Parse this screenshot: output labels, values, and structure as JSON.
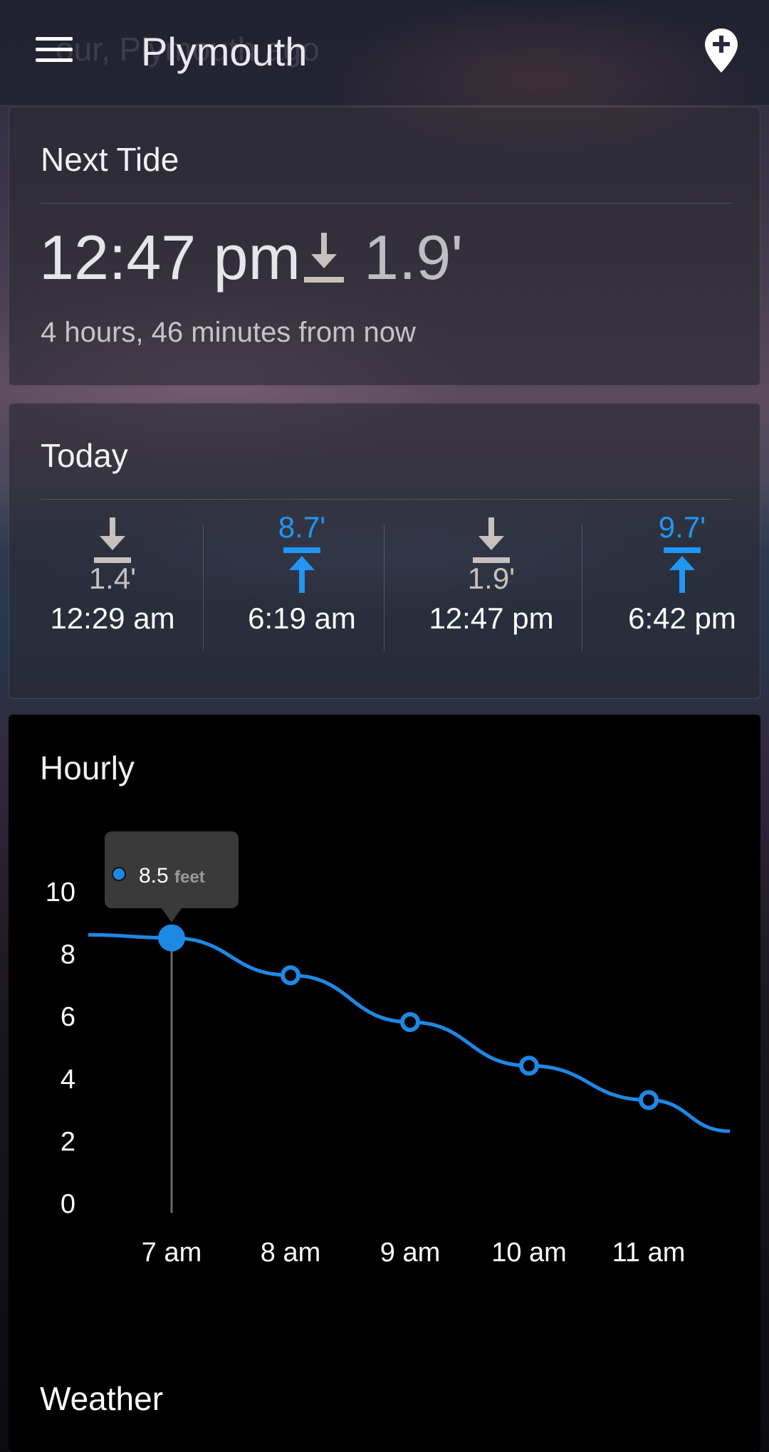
{
  "app_bar": {
    "ghost_text": "our, Plymouth          ago",
    "title": "our, Plymouth",
    "title_visible": "Plymouth",
    "menu_icon": "hamburger-menu-icon",
    "add_location_icon": "add-location-pin-icon"
  },
  "next_tide": {
    "heading": "Next Tide",
    "time": "12:47 pm",
    "type_icon": "low-tide-arrow-icon",
    "height": "1.9'",
    "relative": "4 hours, 46 minutes from now"
  },
  "today": {
    "heading": "Today",
    "tides": [
      {
        "type": "low",
        "height": "1.4'",
        "time": "12:29 am"
      },
      {
        "type": "high",
        "height": "8.7'",
        "time": "6:19 am"
      },
      {
        "type": "low",
        "height": "1.9'",
        "time": "12:47 pm"
      },
      {
        "type": "high",
        "height": "9.7'",
        "time": "6:42 pm"
      }
    ]
  },
  "hourly": {
    "heading": "Hourly",
    "tooltip": {
      "value": "8.5",
      "unit": "feet"
    }
  },
  "chart_data": {
    "type": "line",
    "x": [
      "6:20 am",
      "7 am",
      "8 am",
      "9 am",
      "10 am",
      "11 am",
      "11:40 am"
    ],
    "categories": [
      "7 am",
      "8 am",
      "9 am",
      "10 am",
      "11 am"
    ],
    "values": [
      8.6,
      8.5,
      7.3,
      5.8,
      4.4,
      3.3,
      2.3
    ],
    "marked_points": [
      {
        "x": "7 am",
        "y": 8.5
      },
      {
        "x": "8 am",
        "y": 7.3
      },
      {
        "x": "9 am",
        "y": 5.8
      },
      {
        "x": "10 am",
        "y": 4.4
      },
      {
        "x": "11 am",
        "y": 3.3
      }
    ],
    "yticks": [
      "0",
      "2",
      "4",
      "6",
      "8",
      "10"
    ],
    "ylim": [
      0,
      10
    ],
    "selected": "7 am",
    "series_color": "#1e88e5"
  },
  "weather": {
    "heading": "Weather"
  },
  "colors": {
    "accent_blue": "#2196f3",
    "low_tide_gray": "#c8c0bc"
  }
}
